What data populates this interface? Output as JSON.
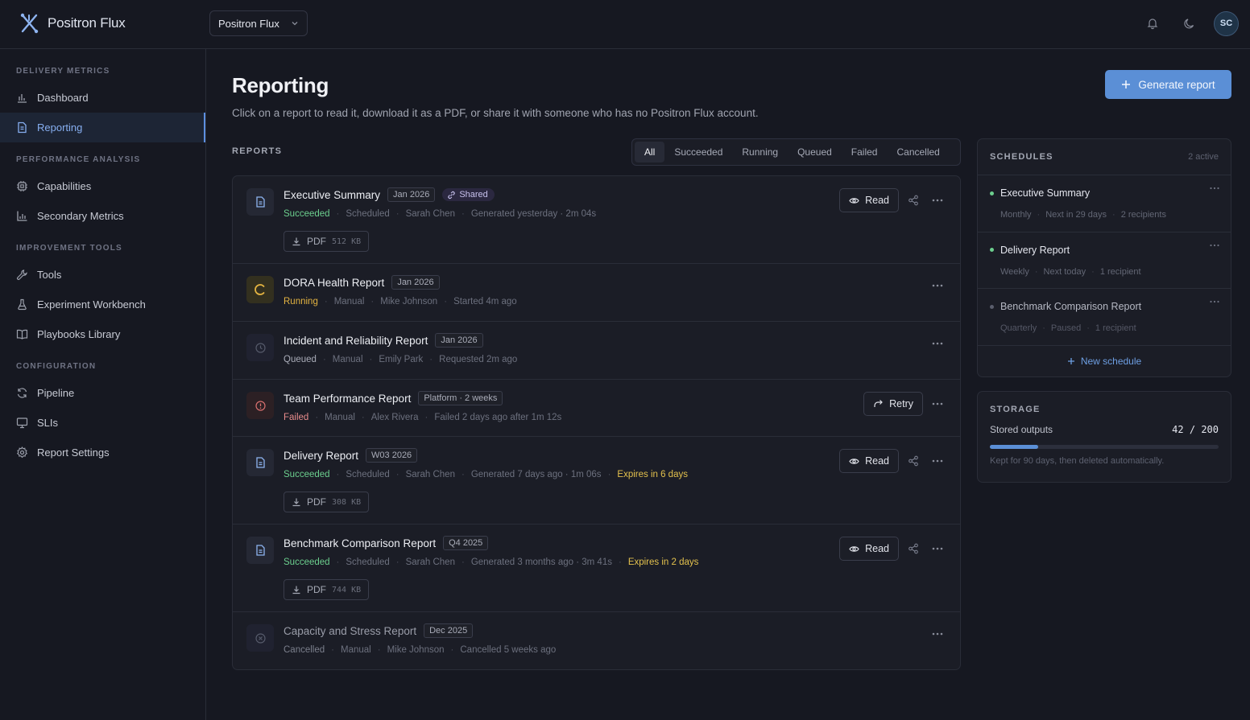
{
  "app": {
    "logo_text": "Positron Flux",
    "project_selector": "Positron Flux",
    "avatar_initials": "SC"
  },
  "sidebar": {
    "sections": [
      {
        "title": "DELIVERY METRICS",
        "items": [
          {
            "label": "Dashboard",
            "icon": "bar-chart-icon",
            "active": false
          },
          {
            "label": "Reporting",
            "icon": "document-icon",
            "active": true
          }
        ]
      },
      {
        "title": "PERFORMANCE ANALYSIS",
        "items": [
          {
            "label": "Capabilities",
            "icon": "chip-icon",
            "active": false
          },
          {
            "label": "Secondary Metrics",
            "icon": "chart-icon",
            "active": false
          }
        ]
      },
      {
        "title": "IMPROVEMENT TOOLS",
        "items": [
          {
            "label": "Tools",
            "icon": "wrench-icon",
            "active": false
          },
          {
            "label": "Experiment Workbench",
            "icon": "flask-icon",
            "active": false
          },
          {
            "label": "Playbooks Library",
            "icon": "book-icon",
            "active": false
          }
        ]
      },
      {
        "title": "CONFIGURATION",
        "items": [
          {
            "label": "Pipeline",
            "icon": "refresh-icon",
            "active": false
          },
          {
            "label": "SLIs",
            "icon": "monitor-icon",
            "active": false
          },
          {
            "label": "Report Settings",
            "icon": "gear-icon",
            "active": false
          }
        ]
      }
    ]
  },
  "page": {
    "title": "Reporting",
    "subtitle": "Click on a report to read it, download it as a PDF, or share it with someone who has no Positron Flux account.",
    "generate_button": "Generate report",
    "reports_label": "REPORTS",
    "filters": [
      "All",
      "Succeeded",
      "Running",
      "Queued",
      "Failed",
      "Cancelled"
    ],
    "active_filter": "All"
  },
  "reports": [
    {
      "name": "Executive Summary",
      "tag": "Jan 2026",
      "shared": "Shared",
      "status": "Succeeded",
      "type": "Scheduled",
      "owner": "Sarah Chen",
      "detail": "Generated yesterday · 2m 04s",
      "expires": "",
      "pdf_label": "PDF",
      "pdf_size": "512 KB",
      "primary_action": "Read"
    },
    {
      "name": "DORA Health Report",
      "tag": "Jan 2026",
      "shared": "",
      "status": "Running",
      "type": "Manual",
      "owner": "Mike Johnson",
      "detail": "Started 4m ago",
      "expires": "",
      "pdf_label": "",
      "pdf_size": "",
      "primary_action": ""
    },
    {
      "name": "Incident and Reliability Report",
      "tag": "Jan 2026",
      "shared": "",
      "status": "Queued",
      "type": "Manual",
      "owner": "Emily Park",
      "detail": "Requested 2m ago",
      "expires": "",
      "pdf_label": "",
      "pdf_size": "",
      "primary_action": ""
    },
    {
      "name": "Team Performance Report",
      "tag": "Platform · 2 weeks",
      "shared": "",
      "status": "Failed",
      "type": "Manual",
      "owner": "Alex Rivera",
      "detail": "Failed 2 days ago after 1m 12s",
      "expires": "",
      "pdf_label": "",
      "pdf_size": "",
      "primary_action": "Retry"
    },
    {
      "name": "Delivery Report",
      "tag": "W03 2026",
      "shared": "",
      "status": "Succeeded",
      "type": "Scheduled",
      "owner": "Sarah Chen",
      "detail": "Generated 7 days ago · 1m 06s",
      "expires": "Expires in 6 days",
      "pdf_label": "PDF",
      "pdf_size": "308 KB",
      "primary_action": "Read"
    },
    {
      "name": "Benchmark Comparison Report",
      "tag": "Q4 2025",
      "shared": "",
      "status": "Succeeded",
      "type": "Scheduled",
      "owner": "Sarah Chen",
      "detail": "Generated 3 months ago · 3m 41s",
      "expires": "Expires in 2 days",
      "pdf_label": "PDF",
      "pdf_size": "744 KB",
      "primary_action": "Read"
    },
    {
      "name": "Capacity and Stress Report",
      "tag": "Dec 2025",
      "shared": "",
      "status": "Cancelled",
      "type": "Manual",
      "owner": "Mike Johnson",
      "detail": "Cancelled 5 weeks ago",
      "expires": "",
      "pdf_label": "",
      "pdf_size": "",
      "primary_action": ""
    }
  ],
  "schedules": {
    "title": "SCHEDULES",
    "count": "2 active",
    "items": [
      {
        "name": "Executive Summary",
        "frequency": "Monthly",
        "next": "Next in 29 days",
        "recipients": "2 recipients",
        "active": true
      },
      {
        "name": "Delivery Report",
        "frequency": "Weekly",
        "next": "Next today",
        "recipients": "1 recipient",
        "active": true
      },
      {
        "name": "Benchmark Comparison Report",
        "frequency": "Quarterly",
        "next": "Paused",
        "recipients": "1 recipient",
        "active": false
      }
    ],
    "new_button": "New schedule"
  },
  "storage": {
    "title": "STORAGE",
    "label": "Stored outputs",
    "used": "42",
    "total": "200",
    "fraction": 0.21,
    "note": "Kept for 90 days, then deleted automatically."
  },
  "colors": {
    "accent": "#5b8fd6",
    "success": "#6ccf8e",
    "running": "#e3b341",
    "failed": "#e88c8c",
    "background": "#161821"
  }
}
